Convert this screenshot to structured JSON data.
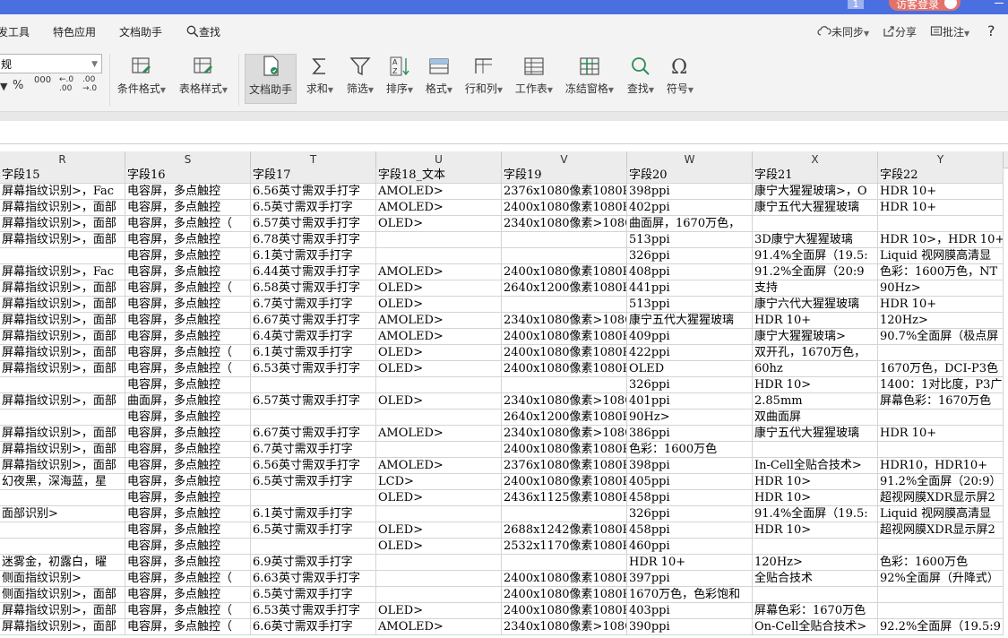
{
  "titlebar": {
    "page_indicator": "1",
    "login_label": "访客登录"
  },
  "menu": {
    "items": [
      "发工具",
      "特色应用",
      "文档助手",
      "查找"
    ],
    "right": {
      "sync": "未同步",
      "share": "分享",
      "comment": "批注",
      "help": "?"
    }
  },
  "ribbon": {
    "number_format_value": "规",
    "format_buttons": [
      "%",
      "000",
      "←.0 .00",
      ".00 →.0"
    ],
    "tools": [
      {
        "label": "条件格式",
        "icon": "conditional-format-icon"
      },
      {
        "label": "表格样式",
        "icon": "table-style-icon"
      },
      {
        "label": "文档助手",
        "icon": "doc-assistant-icon"
      },
      {
        "label": "求和",
        "icon": "sum-icon"
      },
      {
        "label": "筛选",
        "icon": "filter-icon"
      },
      {
        "label": "排序",
        "icon": "sort-icon"
      },
      {
        "label": "格式",
        "icon": "format-icon"
      },
      {
        "label": "行和列",
        "icon": "rows-columns-icon"
      },
      {
        "label": "工作表",
        "icon": "worksheet-icon"
      },
      {
        "label": "冻结窗格",
        "icon": "freeze-panes-icon"
      },
      {
        "label": "查找",
        "icon": "find-icon"
      },
      {
        "label": "符号",
        "icon": "symbol-icon"
      }
    ]
  },
  "sheet": {
    "columns": [
      "R",
      "S",
      "T",
      "U",
      "V",
      "W",
      "X",
      "Y"
    ],
    "header_row": [
      "字段15",
      "字段16",
      "字段17",
      "字段18_文本",
      "字段19",
      "字段20",
      "字段21",
      "字段22"
    ],
    "rows": [
      [
        "屏幕指纹识别>，Fac",
        "电容屏，多点触控",
        "6.56英寸需双手打字",
        "AMOLED>",
        "2376x1080像素1080P",
        "398ppi",
        "康宁大猩猩玻璃>，O",
        "HDR 10+"
      ],
      [
        "屏幕指纹识别>，面部",
        "电容屏，多点触控",
        "6.5英寸需双手打字",
        "AMOLED>",
        "2400x1080像素1080P",
        "402ppi",
        "康宁五代大猩猩玻璃",
        "HDR 10+"
      ],
      [
        "屏幕指纹识别>，面部",
        "电容屏，多点触控（",
        "6.57英寸需双手打字",
        "OLED>",
        "2340x1080像素>1080",
        "曲面屏，1670万色，",
        "",
        ""
      ],
      [
        "屏幕指纹识别>，面部",
        "电容屏，多点触控",
        "6.78英寸需双手打字",
        "",
        "",
        "513ppi",
        "3D康宁大猩猩玻璃",
        "HDR 10>，HDR 10+"
      ],
      [
        "",
        "电容屏，多点触控",
        "6.1英寸需双手打字",
        "",
        "",
        "326ppi",
        "91.4%全面屏（19.5:",
        "Liquid 视网膜高清显"
      ],
      [
        "屏幕指纹识别>，Fac",
        "电容屏，多点触控",
        "6.44英寸需双手打字",
        "AMOLED>",
        "2400x1080像素1080P",
        "408ppi",
        "91.2%全面屏（20:9",
        "色彩：1600万色，NT"
      ],
      [
        "屏幕指纹识别>，面部",
        "电容屏，多点触控（",
        "6.58英寸需双手打字",
        "OLED>",
        "2640x1200像素1080P",
        "441ppi",
        "支持",
        "90Hz>"
      ],
      [
        "屏幕指纹识别>，面部",
        "电容屏，多点触控",
        "6.7英寸需双手打字",
        "OLED>",
        "",
        "513ppi",
        "康宁六代大猩猩玻璃",
        "HDR 10+"
      ],
      [
        "屏幕指纹识别>，面部",
        "电容屏，多点触控",
        "6.67英寸需双手打字",
        "AMOLED>",
        "2340x1080像素>1080",
        "康宁五代大猩猩玻璃",
        "HDR 10+",
        "120Hz>"
      ],
      [
        "屏幕指纹识别>，面部",
        "电容屏，多点触控",
        "6.4英寸需双手打字",
        "AMOLED>",
        "2400x1080像素1080P",
        "409ppi",
        "康宁大猩猩玻璃>",
        "90.7%全面屏（极点屏"
      ],
      [
        "屏幕指纹识别>，面部",
        "电容屏，多点触控（",
        "6.1英寸需双手打字",
        "OLED>",
        "2400x1080像素1080P",
        "422ppi",
        "双开孔，1670万色，",
        ""
      ],
      [
        "屏幕指纹识别>，面部",
        "电容屏，多点触控（",
        "6.53英寸需双手打字",
        "OLED>",
        "2400x1080像素1080P",
        "OLED",
        "60hz",
        "1670万色，DCI-P3色"
      ],
      [
        "",
        "电容屏，多点触控",
        "",
        "",
        "",
        "326ppi",
        "HDR 10>",
        "1400：1对比度，P3广"
      ],
      [
        "屏幕指纹识别>，面部",
        "曲面屏，多点触控",
        "6.57英寸需双手打字",
        "OLED>",
        "2340x1080像素>1080",
        "401ppi",
        "2.85mm",
        "屏幕色彩：1670万色"
      ],
      [
        "",
        "电容屏，多点触控",
        "",
        "",
        "2640x1200像素1080P",
        "90Hz>",
        "双曲面屏",
        ""
      ],
      [
        "屏幕指纹识别>，面部",
        "电容屏，多点触控",
        "6.67英寸需双手打字",
        "AMOLED>",
        "2340x1080像素>1080",
        "386ppi",
        "康宁五代大猩猩玻璃",
        "HDR 10+"
      ],
      [
        "屏幕指纹识别>，面部",
        "电容屏，多点触控",
        "6.7英寸需双手打字",
        "",
        "2400x1080像素1080P",
        "色彩：1600万色",
        "",
        ""
      ],
      [
        "屏幕指纹识别>，面部",
        "电容屏，多点触控",
        "6.56英寸需双手打字",
        "AMOLED>",
        "2376x1080像素1080P",
        "398ppi",
        "In-Cell全贴合技术>",
        "HDR10，HDR10+"
      ],
      [
        "幻夜黑，深海蓝，星",
        "电容屏，多点触控",
        "6.5英寸需双手打字",
        "LCD>",
        "2400x1080像素1080P",
        "405ppi",
        "HDR 10>",
        "91.2%全面屏（20:9）"
      ],
      [
        "",
        "电容屏，多点触控",
        "",
        "OLED>",
        "2436x1125像素1080P",
        "458ppi",
        "HDR 10>",
        "超视网膜XDR显示屏2"
      ],
      [
        "面部识别>",
        "电容屏，多点触控",
        "6.1英寸需双手打字",
        "",
        "",
        "326ppi",
        "91.4%全面屏（19.5:",
        "Liquid 视网膜高清显"
      ],
      [
        "",
        "电容屏，多点触控",
        "6.5英寸需双手打字",
        "OLED>",
        "2688x1242像素1080P",
        "458ppi",
        "HDR 10>",
        "超视网膜XDR显示屏2"
      ],
      [
        "",
        "电容屏，多点触控",
        "",
        "OLED>",
        "2532x1170像素1080P",
        "460ppi",
        "",
        ""
      ],
      [
        "迷雾金，初露白，曜",
        "电容屏，多点触控",
        "6.9英寸需双手打字",
        "",
        "",
        "HDR 10+",
        "120Hz>",
        "色彩：1600万色"
      ],
      [
        "侧面指纹识别>",
        "电容屏，多点触控（",
        "6.63英寸需双手打字",
        "",
        "2400x1080像素1080P",
        "397ppi",
        "全贴合技术",
        "92%全面屏（升降式）"
      ],
      [
        "侧面指纹识别>，面部",
        "电容屏，多点触控",
        "6.5英寸需双手打字",
        "",
        "2400x1080像素1080P",
        "1670万色，色彩饱和",
        "",
        ""
      ],
      [
        "屏幕指纹识别>，面部",
        "电容屏，多点触控（",
        "6.53英寸需双手打字",
        "OLED>",
        "2400x1080像素1080P",
        "403ppi",
        "屏幕色彩：1670万色",
        ""
      ],
      [
        "屏幕指纹识别>，面部",
        "电容屏，多点触控（",
        "6.6英寸需双手打字",
        "AMOLED>",
        "2340x1080像素>1080",
        "390ppi",
        "On-Cell全贴合技术>",
        "92.2%全面屏（19.5:9"
      ]
    ]
  }
}
